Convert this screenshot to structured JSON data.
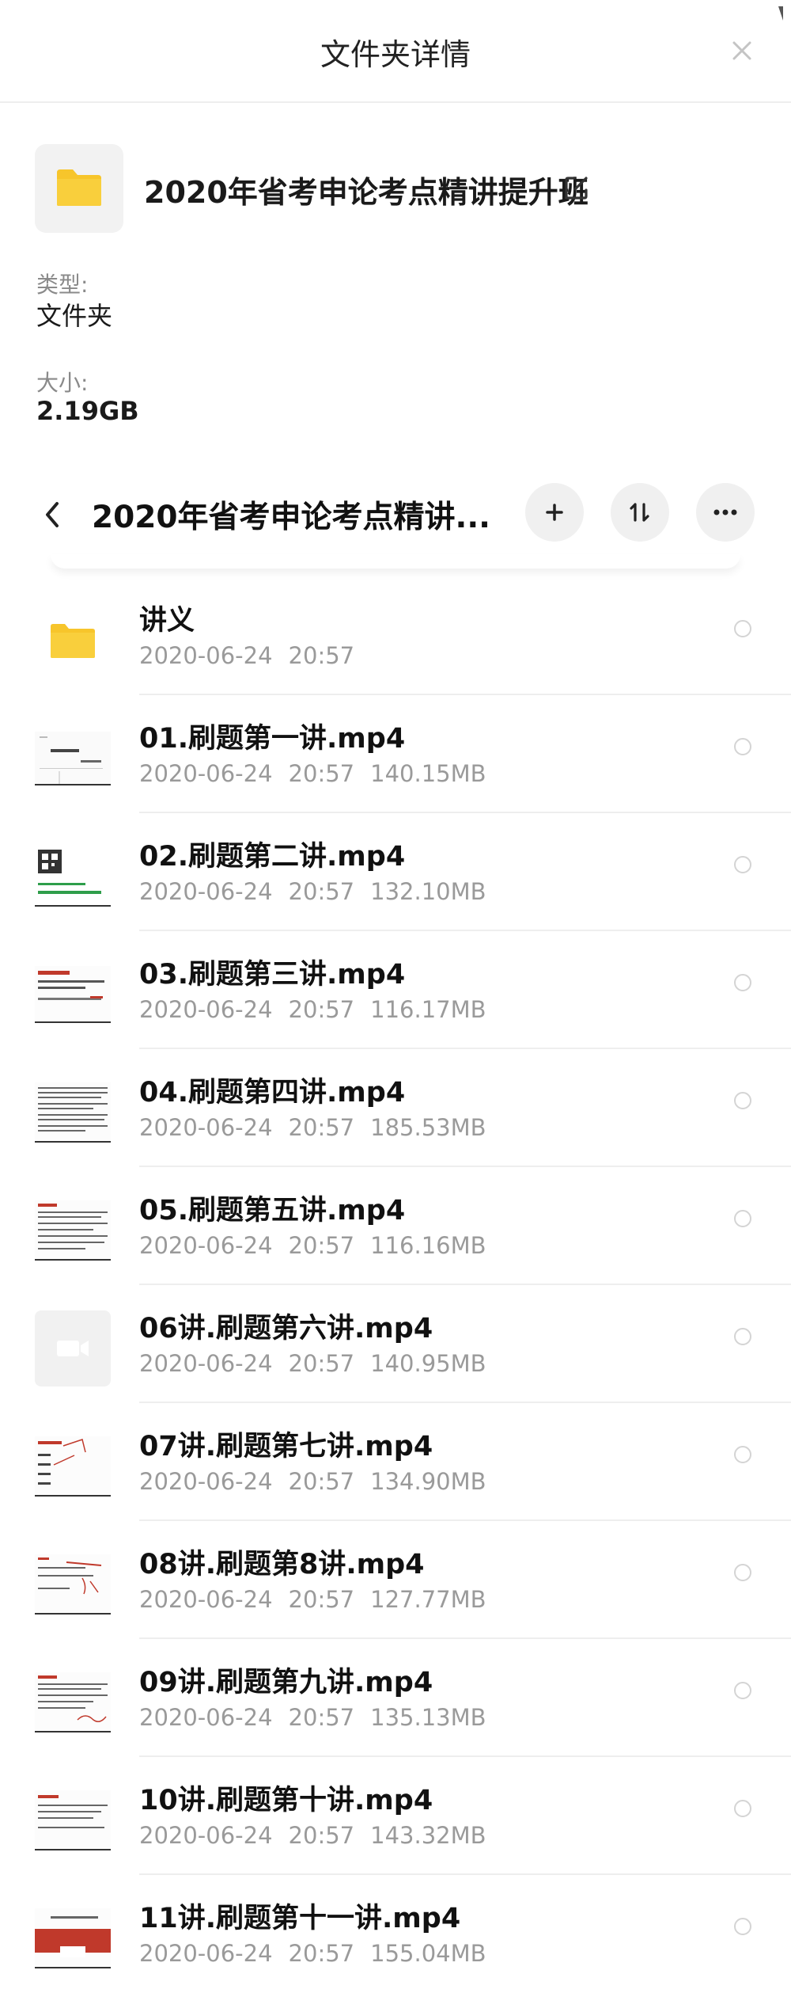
{
  "header": {
    "title": "文件夹详情",
    "close_icon": "close-icon"
  },
  "folder": {
    "icon": "folder-icon",
    "name": "2020年省考申论考点精讲提升班",
    "edit_icon": "edit-external-icon",
    "type_label": "类型:",
    "type_value": "文件夹",
    "size_label": "大小:",
    "size_value": "2.19GB"
  },
  "path_bar": {
    "back_icon": "chevron-left-icon",
    "title": "2020年省考申论考点精讲...",
    "add_icon": "plus-icon",
    "sort_icon": "sort-icon",
    "more_icon": "more-horizontal-icon"
  },
  "files": [
    {
      "name": "讲义",
      "date": "2020-06-24",
      "time": "20:57",
      "size": "",
      "kind": "folder"
    },
    {
      "name": "01.刷题第一讲.mp4",
      "date": "2020-06-24",
      "time": "20:57",
      "size": "140.15MB",
      "kind": "video"
    },
    {
      "name": "02.刷题第二讲.mp4",
      "date": "2020-06-24",
      "time": "20:57",
      "size": "132.10MB",
      "kind": "video"
    },
    {
      "name": "03.刷题第三讲.mp4",
      "date": "2020-06-24",
      "time": "20:57",
      "size": "116.17MB",
      "kind": "video"
    },
    {
      "name": "04.刷题第四讲.mp4",
      "date": "2020-06-24",
      "time": "20:57",
      "size": "185.53MB",
      "kind": "video"
    },
    {
      "name": "05.刷题第五讲.mp4",
      "date": "2020-06-24",
      "time": "20:57",
      "size": "116.16MB",
      "kind": "video"
    },
    {
      "name": "06讲.刷题第六讲.mp4",
      "date": "2020-06-24",
      "time": "20:57",
      "size": "140.95MB",
      "kind": "video-placeholder"
    },
    {
      "name": "07讲.刷题第七讲.mp4",
      "date": "2020-06-24",
      "time": "20:57",
      "size": "134.90MB",
      "kind": "video"
    },
    {
      "name": "08讲.刷题第8讲.mp4",
      "date": "2020-06-24",
      "time": "20:57",
      "size": "127.77MB",
      "kind": "video"
    },
    {
      "name": "09讲.刷题第九讲.mp4",
      "date": "2020-06-24",
      "time": "20:57",
      "size": "135.13MB",
      "kind": "video"
    },
    {
      "name": "10讲.刷题第十讲.mp4",
      "date": "2020-06-24",
      "time": "20:57",
      "size": "143.32MB",
      "kind": "video"
    },
    {
      "name": "11讲.刷题第十一讲.mp4",
      "date": "2020-06-24",
      "time": "20:57",
      "size": "155.04MB",
      "kind": "video"
    }
  ],
  "colors": {
    "folder_yellow": "#F7C52B",
    "accent_red": "#c0392b",
    "meta_gray": "#9a9a9a",
    "divider": "#eeeeee"
  }
}
